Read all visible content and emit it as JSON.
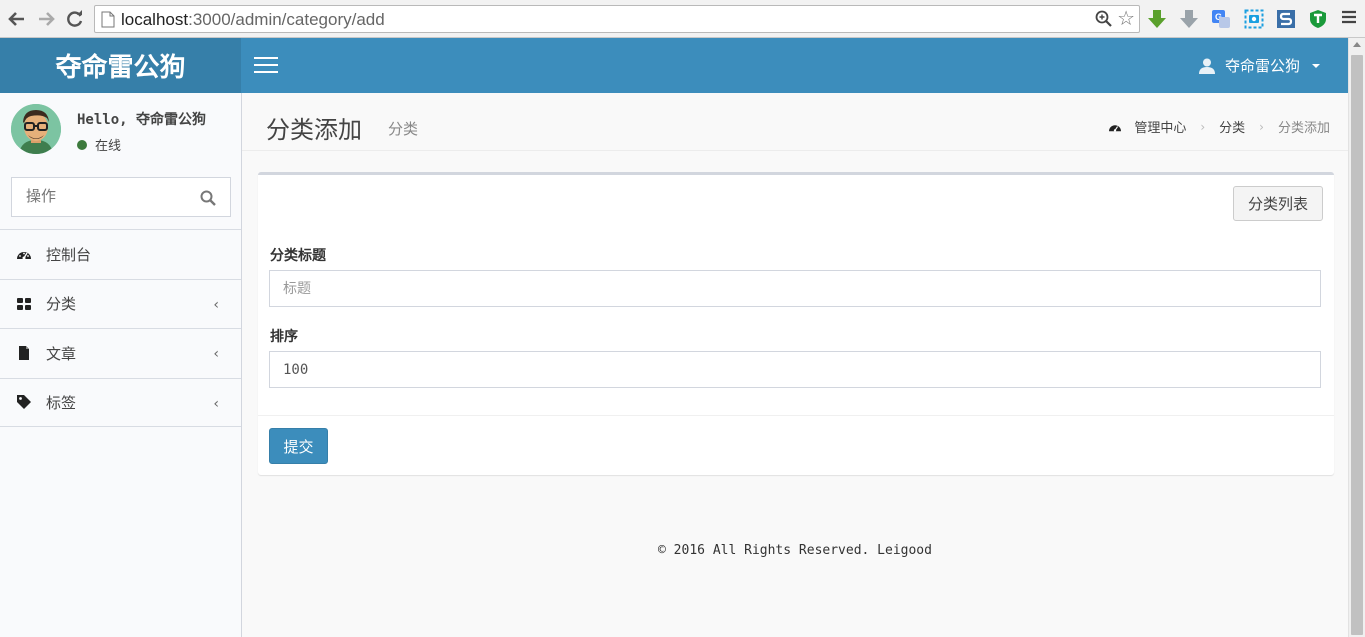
{
  "browser": {
    "url_host": "localhost",
    "url_path": ":3000/admin/category/add",
    "colors": {
      "download_green": "#5aa02c",
      "translate_blue": "#4285f4"
    }
  },
  "header": {
    "logo": "夺命雷公狗",
    "user_name": "夺命雷公狗",
    "colors": {
      "bar": "#3c8dbc",
      "logo_bg": "#367fa9"
    }
  },
  "sidebar": {
    "greeting": "Hello, 夺命雷公狗",
    "status": "在线",
    "search_placeholder": "操作",
    "items": [
      {
        "label": "控制台",
        "icon": "dashboard-icon",
        "has_submenu": false
      },
      {
        "label": "分类",
        "icon": "grid-icon",
        "has_submenu": true
      },
      {
        "label": "文章",
        "icon": "file-icon",
        "has_submenu": true
      },
      {
        "label": "标签",
        "icon": "tag-icon",
        "has_submenu": true
      }
    ]
  },
  "page": {
    "title": "分类添加",
    "subtitle": "分类",
    "breadcrumb": [
      "管理中心",
      "分类",
      "分类添加"
    ]
  },
  "form": {
    "list_button": "分类列表",
    "title_label": "分类标题",
    "title_placeholder": "标题",
    "title_value": "",
    "sort_label": "排序",
    "sort_value": "100",
    "submit_label": "提交"
  },
  "footer": {
    "text": "© 2016 All Rights Reserved. Leigood"
  }
}
